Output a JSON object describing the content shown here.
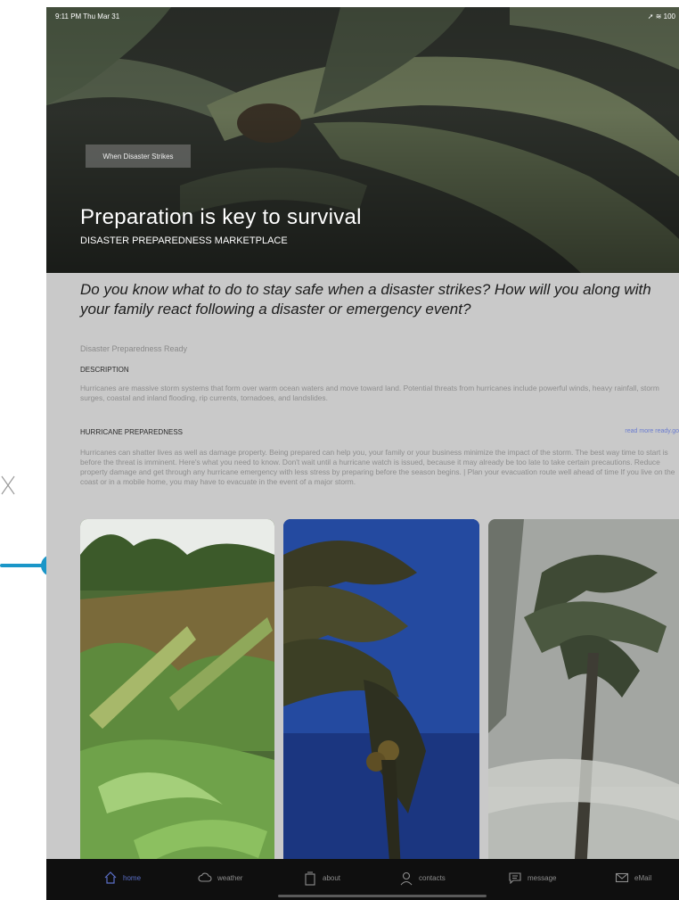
{
  "status": {
    "time": "9:11 PM  Thu Mar 31",
    "battery": "100"
  },
  "hero": {
    "chip": "When Disaster Strikes",
    "title": "Preparation is key to survival",
    "subtitle": "DISASTER PREPAREDNESS MARKETPLACE"
  },
  "content": {
    "question": "Do you know what to do to stay safe when a disaster strikes? How will you along with your family react following a disaster or emergency event?",
    "ready_label": "Disaster Preparedness Ready",
    "description_heading": "DESCRIPTION",
    "description_text": "Hurricanes are massive storm systems that form over warm ocean waters and move toward land. Potential threats from hurricanes include powerful winds, heavy rainfall, storm surges, coastal and inland flooding, rip currents, tornadoes, and landslides.",
    "hurricane_heading": "HURRICANE PREPAREDNESS",
    "read_more": "read more ready.go",
    "hurricane_text": "Hurricanes can shatter lives as well as damage property. Being prepared can help you, your family or your business minimize the impact of the storm. The best way time to start is before the threat is imminent. Here's what you need to know. Don't wait until a hurricane watch is issued, because it may already be too late to take certain precautions. Reduce property damage and get through any hurricane emergency with less stress by preparing before the season begins. | Plan your evacuation route well ahead of time If you live on the coast or in a mobile home, you may have to evacuate in the event of a major storm."
  },
  "tabs": [
    {
      "label": "home",
      "icon": "home-icon",
      "active": true
    },
    {
      "label": "weather",
      "icon": "cloud-icon"
    },
    {
      "label": "about",
      "icon": "document-icon"
    },
    {
      "label": "contacts",
      "icon": "person-icon"
    },
    {
      "label": "message",
      "icon": "message-icon"
    },
    {
      "label": "eMail",
      "icon": "mail-icon"
    }
  ],
  "colors": {
    "accent": "#1a96c8",
    "active_tab": "#5b6fc8",
    "link": "#6a7cd0"
  }
}
